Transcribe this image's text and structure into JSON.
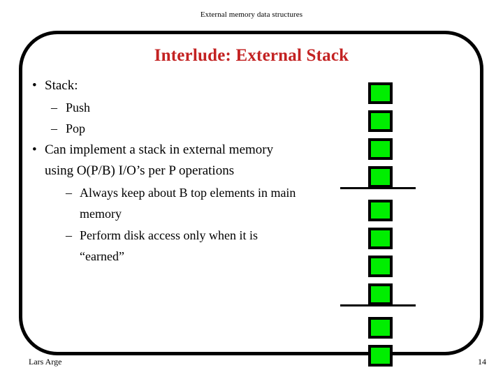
{
  "slide": {
    "header": "External memory data structures",
    "title": "Interlude: External Stack",
    "title_color": "#C32222",
    "border_color": "#000000",
    "background_color": "#FFFFFF"
  },
  "body": {
    "items": [
      {
        "level": 1,
        "marker": "•",
        "text": "Stack:"
      },
      {
        "level": 2,
        "marker": "–",
        "text": "Push"
      },
      {
        "level": 2,
        "marker": "–",
        "text": "Pop"
      },
      {
        "level": 1,
        "marker": "•",
        "text": "Can implement a stack in external memory using O(P/B) I/O’s per P operations"
      },
      {
        "level": 3,
        "marker": "–",
        "text": "Always keep about B top elements in main memory"
      },
      {
        "level": 3,
        "marker": "–",
        "text": "Perform disk access only when it is “earned”"
      }
    ],
    "item_0_text": "Stack:",
    "item_1_text": "Push",
    "item_2_text": "Pop",
    "item_3_text": "Can implement a stack in external memory using O(P/B) I/O’s per P operations",
    "item_4_text": "Always keep about B top elements in main memory",
    "item_5_text": "Perform disk access only when it is “earned”",
    "bullet_dot": "•",
    "bullet_dash": "–"
  },
  "diagram": {
    "name": "external-stack-blocks",
    "block_color": "#00EE00",
    "block_border_color": "#000000",
    "block_count": 10,
    "block_tops": [
      0,
      40,
      80,
      120,
      168,
      208,
      248,
      288,
      336,
      376
    ],
    "divider_count": 2,
    "divider_tops": [
      150,
      318
    ]
  },
  "footer": {
    "author": "Lars Arge",
    "page_number": "14"
  }
}
